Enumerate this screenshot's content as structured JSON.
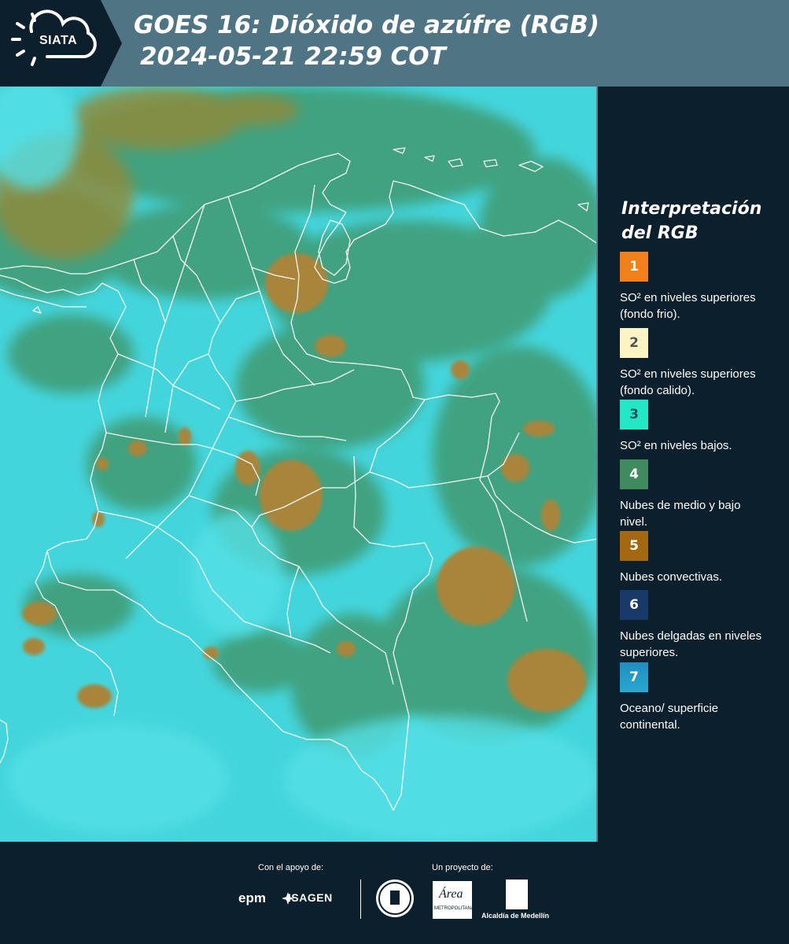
{
  "header": {
    "logo_text": "SIATA",
    "title_line1": "GOES 16: Dióxido de azúfre (RGB)",
    "title_line2": "2024-05-21 22:59 COT"
  },
  "legend": {
    "title": "Interpretación del RGB",
    "items": [
      {
        "number": "1",
        "color": "#f2801a",
        "number_color": "#ffffff",
        "text": "SO² en niveles superiores (fondo frio)."
      },
      {
        "number": "2",
        "color": "#fdf4c3",
        "number_color": "#555555",
        "text": "SO² en niveles superiores (fondo calido)."
      },
      {
        "number": "3",
        "color": "#22e8c5",
        "number_color": "#2a4d5e",
        "text": "SO² en niveles bajos."
      },
      {
        "number": "4",
        "color": "#3f8b5f",
        "number_color": "#ffffff",
        "text": "Nubes de medio y bajo nivel."
      },
      {
        "number": "5",
        "color": "#a36810",
        "number_color": "#ffffff",
        "text": "Nubes convectivas."
      },
      {
        "number": "6",
        "color": "#173a6b",
        "number_color": "#ffffff",
        "text": "Nubes delgadas en niveles superiores."
      },
      {
        "number": "7",
        "color": "#1f92c2",
        "number_color": "#ffffff",
        "text": "Oceano/ superficie continental."
      }
    ]
  },
  "footer": {
    "support_label": "Con el apoyo de:",
    "project_label": "Un proyecto de:",
    "sponsor1": "epm",
    "sponsor2": "ISAGEN",
    "area_logo_text": "Área",
    "area_logo_sub": "METROPOLITANA",
    "alcaldia": "Alcaldía de Medellín"
  },
  "colors": {
    "header_bg": "#4f7585",
    "logo_bg": "#0b1f2c",
    "panel_bg": "#0b1f2c",
    "map_cyan": "#3fd6dc",
    "map_green": "#3f9a6f",
    "map_brown": "#a8853a"
  },
  "icons": [
    "siata-sun-cloud-icon",
    "isagen-star-icon",
    "medellin-seal-icon",
    "area-metropolitana-icon",
    "alcaldia-shield-icon"
  ]
}
